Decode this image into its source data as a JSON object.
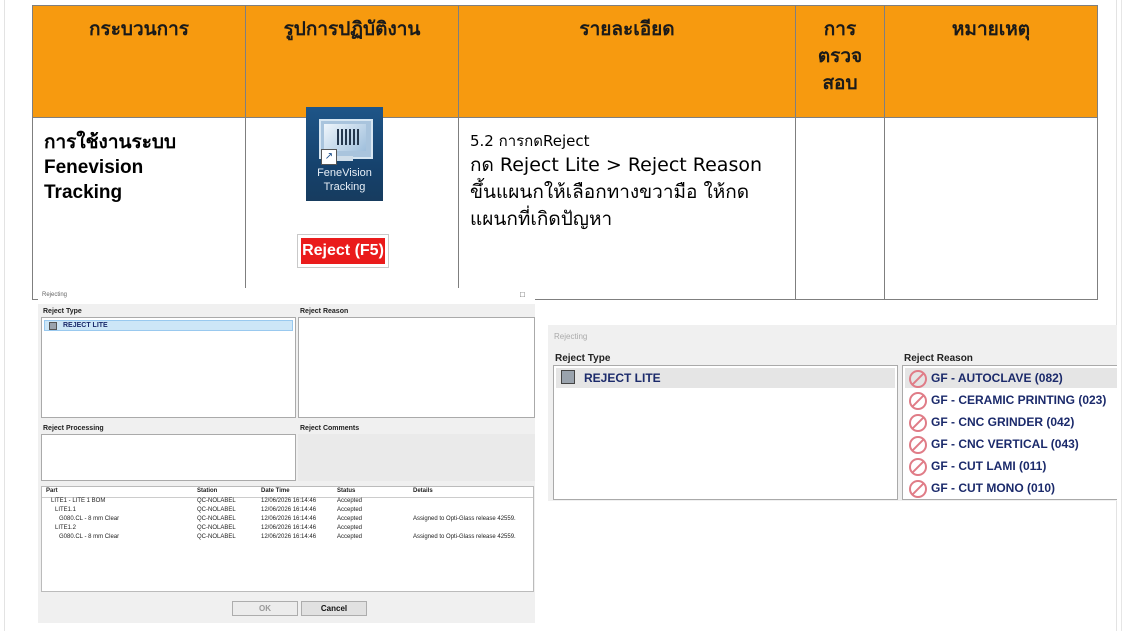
{
  "table": {
    "headers": [
      "กระบวนการ",
      "รูปการปฏิบัติงาน",
      "รายละเอียด",
      "การ\nตรวจ\nสอบ",
      "หมายเหตุ"
    ],
    "row": {
      "process": "การใช้งานระบบ\nFenevision\nTracking",
      "detail_small": "5.2 การกดReject",
      "detail_big": "กด Reject Lite > Reject Reason\nขึ้นแผนกให้เลือกทางขวามือ ให้กด\nแผนกที่เกิดปัญหา"
    }
  },
  "app_icon": {
    "label": "FeneVision\nTracking",
    "icon": "fenevision-tracking-icon"
  },
  "reject_button": {
    "label": "Reject (F5)",
    "color": "#ea1b1b"
  },
  "dialog_large": {
    "title": "Rejecting",
    "maximize": "□",
    "reject_type_label": "Reject Type",
    "reject_type_item": "REJECT LITE",
    "reject_reason_label": "Reject Reason",
    "reject_processing_label": "Reject Processing",
    "reject_comments_label": "Reject Comments",
    "grid": {
      "columns": [
        "Part",
        "Station",
        "Date Time",
        "Status",
        "Details"
      ],
      "rows": [
        {
          "part": "LITE1 - LITE 1 BOM",
          "station": "QC-NOLABEL",
          "datetime": "12/06/2026 16:14:46",
          "status": "Accepted",
          "details": ""
        },
        {
          "part": "LITE1.1",
          "station": "QC-NOLABEL",
          "datetime": "12/06/2026 16:14:46",
          "status": "Accepted",
          "details": ""
        },
        {
          "part": "G080.CL - 8 mm Clear",
          "station": "QC-NOLABEL",
          "datetime": "12/06/2026 16:14:46",
          "status": "Accepted",
          "details": "Assigned to Opti-Glass release 42559."
        },
        {
          "part": "LITE1.2",
          "station": "QC-NOLABEL",
          "datetime": "12/06/2026 16:14:46",
          "status": "Accepted",
          "details": ""
        },
        {
          "part": "G080.CL - 8 mm Clear",
          "station": "QC-NOLABEL",
          "datetime": "12/06/2026 16:14:46",
          "status": "Accepted",
          "details": "Assigned to Opti-Glass release 42559."
        }
      ]
    },
    "ok_label": "OK",
    "cancel_label": "Cancel"
  },
  "dialog_zoom": {
    "title": "Rejecting",
    "reject_type_label": "Reject Type",
    "reject_type_item": "REJECT LITE",
    "reject_reason_label": "Reject Reason",
    "reasons": [
      "GF - AUTOCLAVE (082)",
      "GF - CERAMIC PRINTING (023)",
      "GF - CNC GRINDER (042)",
      "GF - CNC VERTICAL (043)",
      "GF - CUT LAMI (011)",
      "GF - CUT MONO (010)"
    ]
  }
}
